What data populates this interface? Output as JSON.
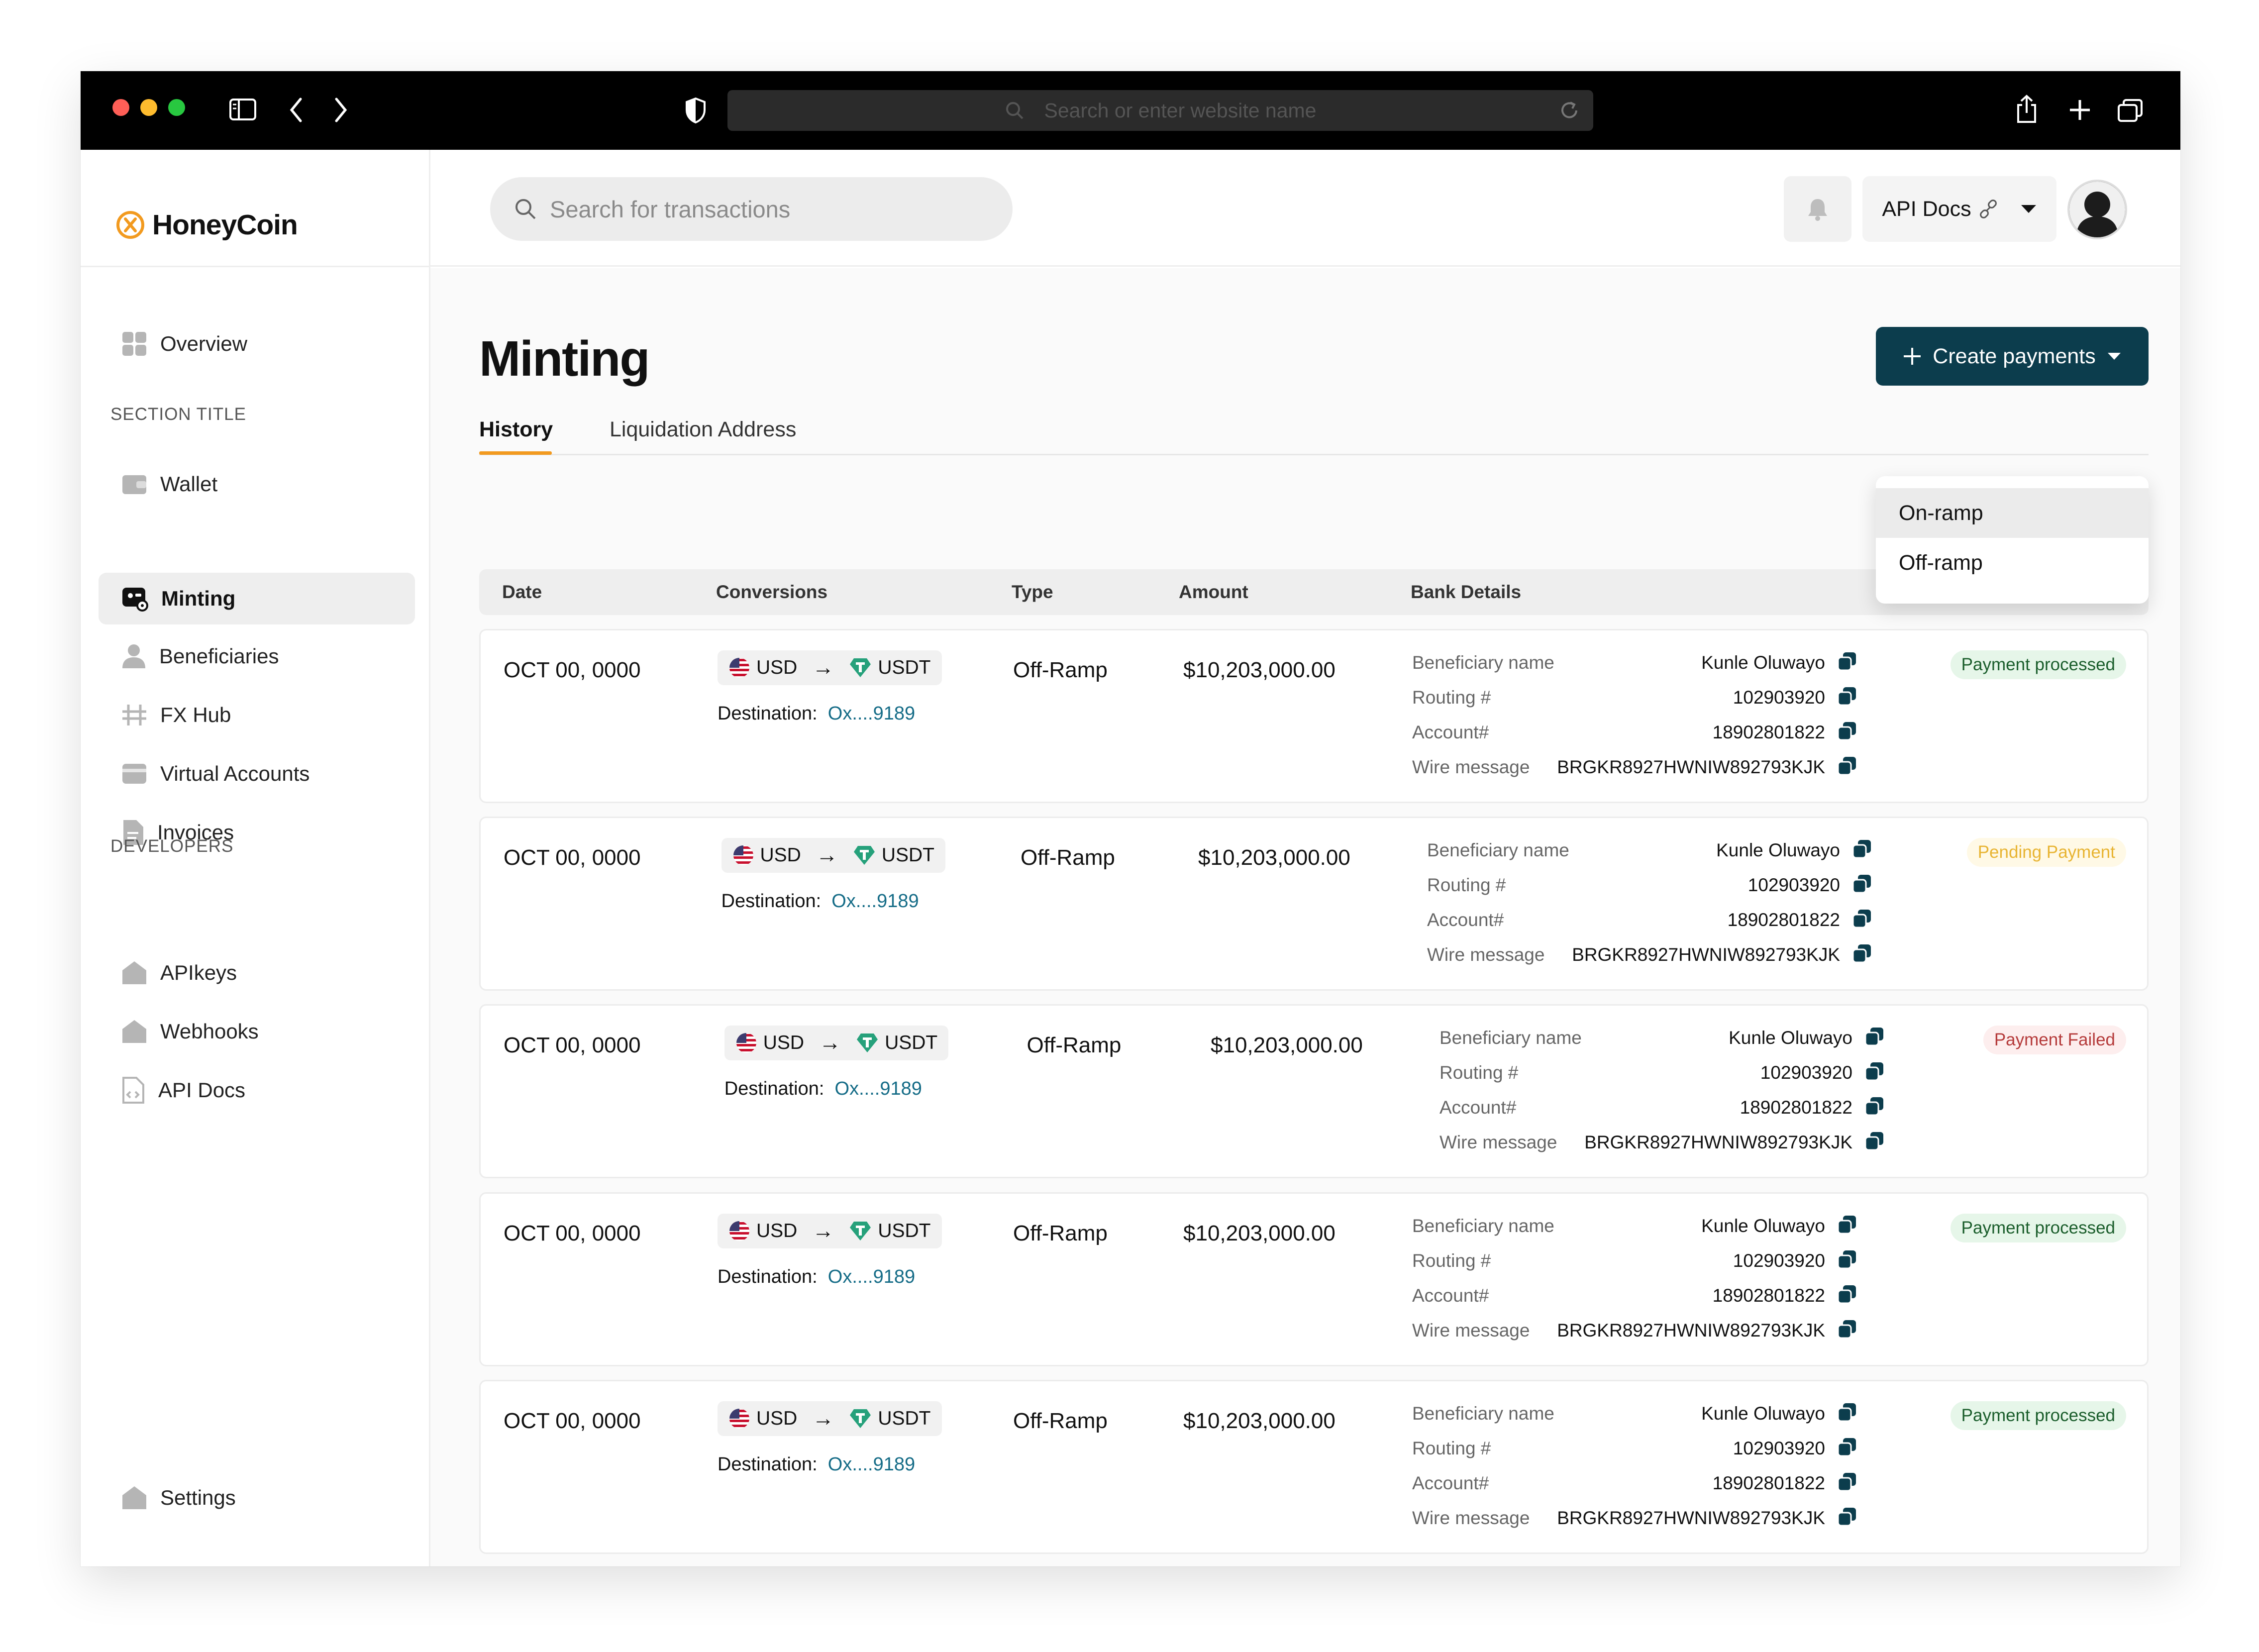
{
  "browser": {
    "url_placeholder": "Search or enter website name"
  },
  "brand": {
    "name": "HoneyCoin",
    "accent": "#f29a1f",
    "primary": "#0c3d4d"
  },
  "sidebar": {
    "items": [
      {
        "label": "Overview",
        "icon": "grid-icon"
      },
      {
        "label": "Wallet",
        "icon": "wallet-icon"
      },
      {
        "label": "Minting",
        "icon": "minting-icon",
        "active": true
      },
      {
        "label": "Beneficiaries",
        "icon": "user-icon"
      },
      {
        "label": "FX Hub",
        "icon": "fx-icon"
      },
      {
        "label": "Virtual Accounts",
        "icon": "card-icon"
      },
      {
        "label": "Invoices",
        "icon": "document-icon"
      }
    ],
    "section_title": "SECTION TITLE",
    "developers_title": "DEVELOPERS",
    "dev_items": [
      {
        "label": "APIkeys",
        "icon": "home-icon"
      },
      {
        "label": "Webhooks",
        "icon": "home-icon"
      },
      {
        "label": "API Docs",
        "icon": "code-doc-icon"
      }
    ],
    "settings": "Settings"
  },
  "header": {
    "search_placeholder": "Search for transactions",
    "api_docs": "API Docs"
  },
  "page": {
    "title": "Minting",
    "create_button": "Create payments",
    "tabs": [
      "History",
      "Liquidation Address"
    ],
    "menu": [
      "On-ramp",
      "Off-ramp"
    ]
  },
  "table": {
    "columns": [
      "Date",
      "Conversions",
      "Type",
      "Amount",
      "Bank Details"
    ],
    "bank_keys": [
      "Beneficiary name",
      "Routing #",
      "Account#",
      "Wire message"
    ],
    "rows": [
      {
        "date": "OCT 00, 0000",
        "from": "USD",
        "to": "USDT",
        "dest_label": "Destination:",
        "dest": "Ox....9189",
        "type": "Off-Ramp",
        "amount": "$10,203,000.00",
        "bank": [
          "Kunle Oluwayo",
          "102903920",
          "18902801822",
          "BRGKR8927HWNIW892793KJK"
        ],
        "status": "Payment processed",
        "status_kind": "ok"
      },
      {
        "date": "OCT 00, 0000",
        "from": "USD",
        "to": "USDT",
        "dest_label": "Destination:",
        "dest": "Ox....9189",
        "type": "Off-Ramp",
        "amount": "$10,203,000.00",
        "bank": [
          "Kunle Oluwayo",
          "102903920",
          "18902801822",
          "BRGKR8927HWNIW892793KJK"
        ],
        "status": "Pending Payment",
        "status_kind": "pending"
      },
      {
        "date": "OCT 00, 0000",
        "from": "USD",
        "to": "USDT",
        "dest_label": "Destination:",
        "dest": "Ox....9189",
        "type": "Off-Ramp",
        "amount": "$10,203,000.00",
        "bank": [
          "Kunle Oluwayo",
          "102903920",
          "18902801822",
          "BRGKR8927HWNIW892793KJK"
        ],
        "status": "Payment Failed",
        "status_kind": "failed"
      },
      {
        "date": "OCT 00, 0000",
        "from": "USD",
        "to": "USDT",
        "dest_label": "Destination:",
        "dest": "Ox....9189",
        "type": "Off-Ramp",
        "amount": "$10,203,000.00",
        "bank": [
          "Kunle Oluwayo",
          "102903920",
          "18902801822",
          "BRGKR8927HWNIW892793KJK"
        ],
        "status": "Payment processed",
        "status_kind": "ok"
      },
      {
        "date": "OCT 00, 0000",
        "from": "USD",
        "to": "USDT",
        "dest_label": "Destination:",
        "dest": "Ox....9189",
        "type": "Off-Ramp",
        "amount": "$10,203,000.00",
        "bank": [
          "Kunle Oluwayo",
          "102903920",
          "18902801822",
          "BRGKR8927HWNIW892793KJK"
        ],
        "status": "Payment processed",
        "status_kind": "ok"
      }
    ]
  }
}
